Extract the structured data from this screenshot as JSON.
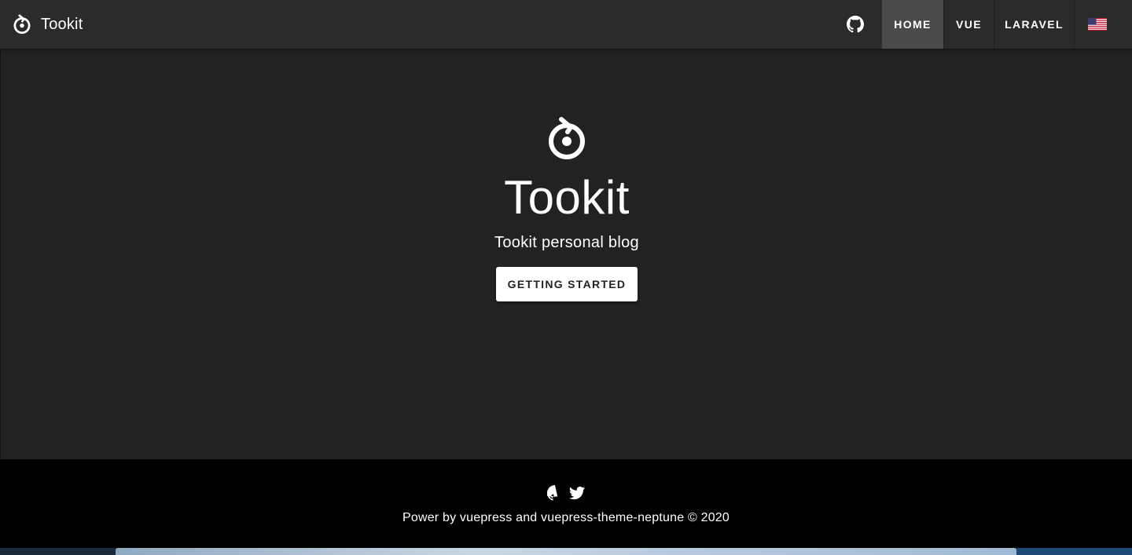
{
  "header": {
    "brand_title": "Tookit",
    "nav": {
      "home": "HOME",
      "vue": "VUE",
      "laravel": "LARAVEL"
    },
    "icons": {
      "logo": "tookit-logo-icon",
      "github": "github-icon",
      "language": "us-flag-icon"
    }
  },
  "hero": {
    "title": "Tookit",
    "subtitle": "Tookit personal blog",
    "action_label": "GETTING STARTED"
  },
  "footer": {
    "text": "Power by vuepress and vuepress-theme-neptune © 2020",
    "icons": [
      "github-icon",
      "twitter-icon"
    ]
  },
  "colors": {
    "page_background": "#222222",
    "appbar_background": "#2b2b2b",
    "active_nav_background": "#4a4a4a",
    "footer_background": "#000000",
    "button_background": "#ffffff",
    "button_text": "#222222"
  }
}
